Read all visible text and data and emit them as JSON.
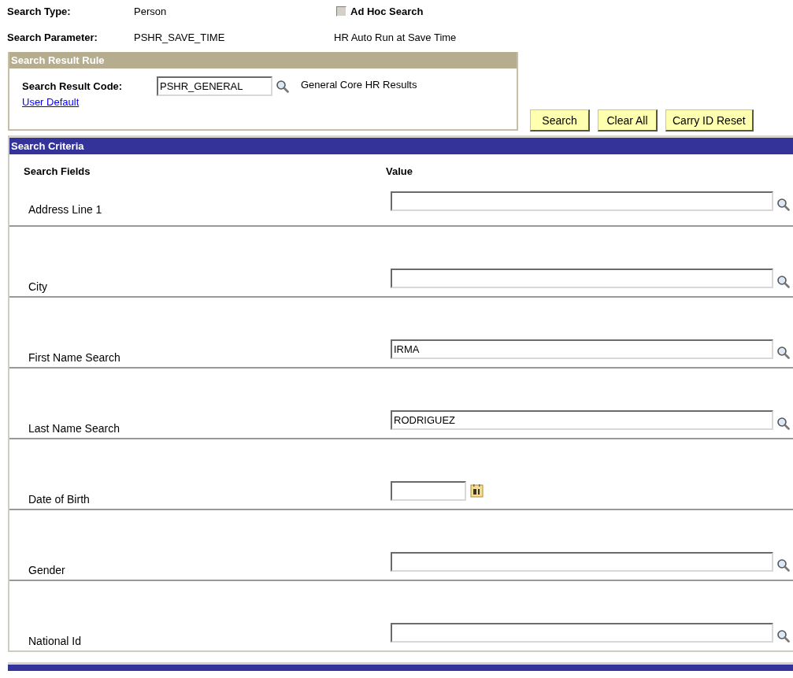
{
  "search_type": {
    "label": "Search Type:",
    "value": "Person"
  },
  "ad_hoc_search": {
    "label": "Ad Hoc Search",
    "checked": false,
    "disabled": true
  },
  "search_parameter": {
    "label": "Search Parameter:",
    "value": "PSHR_SAVE_TIME",
    "description": "HR Auto Run at Save Time"
  },
  "search_result_rule": {
    "title": "Search Result Rule",
    "code_label": "Search Result Code:",
    "code_value": "PSHR_GENERAL",
    "code_description": "General Core HR Results",
    "link": "User Default"
  },
  "buttons": [
    "Search",
    "Clear All",
    "Carry ID Reset"
  ],
  "search_criteria": {
    "title": "Search Criteria",
    "columns": [
      "Search Fields",
      "Value"
    ],
    "rows": [
      {
        "label": "Address Line 1",
        "kind": "lookup"
      },
      {
        "label": "City",
        "kind": "lookup"
      },
      {
        "label": "First Name Search",
        "kind": "lookup",
        "value": "IRMA"
      },
      {
        "label": "Last Name Search",
        "kind": "lookup",
        "value": "RODRIGUEZ"
      },
      {
        "label": "Date of Birth",
        "kind": "date"
      },
      {
        "label": "Gender",
        "kind": "lookup"
      },
      {
        "label": "National Id",
        "kind": "lookup"
      }
    ]
  }
}
